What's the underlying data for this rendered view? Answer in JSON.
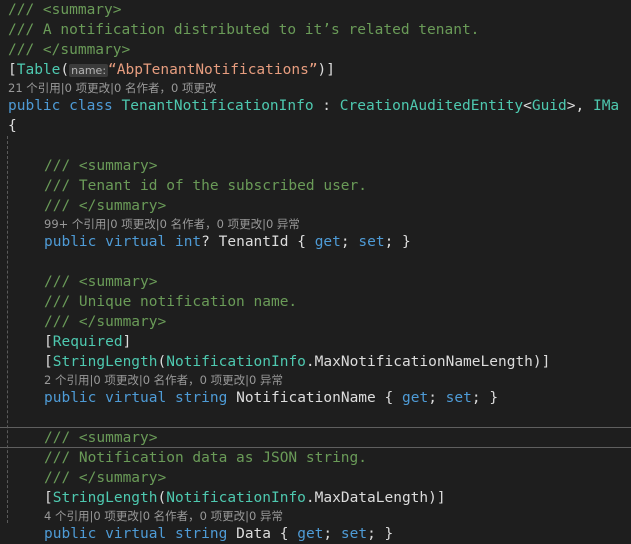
{
  "editor": {
    "name": "code-editor-pane",
    "background": "#1e1e1e",
    "foreground": "#dcdcdc",
    "language": "csharp",
    "colors": {
      "comment": "#6a9b58",
      "keyword": "#4e9bd6",
      "type": "#4ec9b0",
      "string": "#e79d7f",
      "identifier": "#dcdcdc",
      "codelens": "#999999",
      "indent_guide": "#5a5a5a",
      "current_line_border": "#5f5f5f",
      "inline_hint_background": "#3b3b3b"
    }
  },
  "code_lines": [
    {
      "indent": 0,
      "tokens": [
        {
          "c": "cm",
          "t": "/// "
        },
        {
          "c": "cmtag",
          "t": "<summary>"
        }
      ]
    },
    {
      "indent": 0,
      "tokens": [
        {
          "c": "cm",
          "t": "/// A notification distributed to it’s related tenant."
        }
      ]
    },
    {
      "indent": 0,
      "tokens": [
        {
          "c": "cm",
          "t": "/// "
        },
        {
          "c": "cmtag",
          "t": "</summary>"
        }
      ]
    },
    {
      "indent": 0,
      "tokens": [
        {
          "c": "punc",
          "t": "["
        },
        {
          "c": "type",
          "t": "Table"
        },
        {
          "c": "punc",
          "t": "("
        },
        {
          "c": "hint",
          "t": "name:"
        },
        {
          "c": "str",
          "t": "“AbpTenantNotifications”"
        },
        {
          "c": "punc",
          "t": ")]"
        }
      ]
    },
    {
      "codelens": true,
      "text": "21 个引用|0 项更改|0 名作者，0 项更改"
    },
    {
      "indent": 0,
      "tokens": [
        {
          "c": "kw",
          "t": "public"
        },
        {
          "c": "id",
          "t": " "
        },
        {
          "c": "kw",
          "t": "class"
        },
        {
          "c": "id",
          "t": " "
        },
        {
          "c": "type",
          "t": "TenantNotificationInfo"
        },
        {
          "c": "punc",
          "t": " : "
        },
        {
          "c": "type",
          "t": "CreationAuditedEntity"
        },
        {
          "c": "punc",
          "t": "<"
        },
        {
          "c": "type",
          "t": "Guid"
        },
        {
          "c": "punc",
          "t": ">, "
        },
        {
          "c": "type",
          "t": "IMa"
        }
      ]
    },
    {
      "indent": 0,
      "tokens": [
        {
          "c": "punc",
          "t": "{"
        }
      ]
    },
    {
      "blank": true
    },
    {
      "indent": 1,
      "tokens": [
        {
          "c": "cm",
          "t": "/// "
        },
        {
          "c": "cmtag",
          "t": "<summary>"
        }
      ]
    },
    {
      "indent": 1,
      "tokens": [
        {
          "c": "cm",
          "t": "/// Tenant id of the subscribed user."
        }
      ]
    },
    {
      "indent": 1,
      "tokens": [
        {
          "c": "cm",
          "t": "/// "
        },
        {
          "c": "cmtag",
          "t": "</summary>"
        }
      ]
    },
    {
      "codelens": true,
      "indent": 1,
      "text": "99+ 个引用|0 项更改|0 名作者，0 项更改|0 异常"
    },
    {
      "indent": 1,
      "tokens": [
        {
          "c": "kw",
          "t": "public"
        },
        {
          "c": "id",
          "t": " "
        },
        {
          "c": "kw",
          "t": "virtual"
        },
        {
          "c": "id",
          "t": " "
        },
        {
          "c": "kw",
          "t": "int"
        },
        {
          "c": "punc",
          "t": "? "
        },
        {
          "c": "id",
          "t": "TenantId"
        },
        {
          "c": "punc",
          "t": " { "
        },
        {
          "c": "kw",
          "t": "get"
        },
        {
          "c": "punc",
          "t": "; "
        },
        {
          "c": "kw",
          "t": "set"
        },
        {
          "c": "punc",
          "t": "; }"
        }
      ]
    },
    {
      "blank": true
    },
    {
      "indent": 1,
      "tokens": [
        {
          "c": "cm",
          "t": "/// "
        },
        {
          "c": "cmtag",
          "t": "<summary>"
        }
      ]
    },
    {
      "indent": 1,
      "tokens": [
        {
          "c": "cm",
          "t": "/// Unique notification name."
        }
      ]
    },
    {
      "indent": 1,
      "tokens": [
        {
          "c": "cm",
          "t": "/// "
        },
        {
          "c": "cmtag",
          "t": "</summary>"
        }
      ]
    },
    {
      "indent": 1,
      "tokens": [
        {
          "c": "punc",
          "t": "["
        },
        {
          "c": "type",
          "t": "Required"
        },
        {
          "c": "punc",
          "t": "]"
        }
      ]
    },
    {
      "indent": 1,
      "tokens": [
        {
          "c": "punc",
          "t": "["
        },
        {
          "c": "type",
          "t": "StringLength"
        },
        {
          "c": "punc",
          "t": "("
        },
        {
          "c": "type",
          "t": "NotificationInfo"
        },
        {
          "c": "punc",
          "t": "."
        },
        {
          "c": "id",
          "t": "MaxNotificationNameLength"
        },
        {
          "c": "punc",
          "t": ")]"
        }
      ]
    },
    {
      "codelens": true,
      "indent": 1,
      "text": "2 个引用|0 项更改|0 名作者，0 项更改|0 异常"
    },
    {
      "indent": 1,
      "tokens": [
        {
          "c": "kw",
          "t": "public"
        },
        {
          "c": "id",
          "t": " "
        },
        {
          "c": "kw",
          "t": "virtual"
        },
        {
          "c": "id",
          "t": " "
        },
        {
          "c": "kw",
          "t": "string"
        },
        {
          "c": "id",
          "t": " "
        },
        {
          "c": "id",
          "t": "NotificationName"
        },
        {
          "c": "punc",
          "t": " { "
        },
        {
          "c": "kw",
          "t": "get"
        },
        {
          "c": "punc",
          "t": "; "
        },
        {
          "c": "kw",
          "t": "set"
        },
        {
          "c": "punc",
          "t": "; }"
        }
      ]
    },
    {
      "blank": true
    },
    {
      "indent": 1,
      "current": true,
      "tokens": [
        {
          "c": "cm",
          "t": "/// "
        },
        {
          "c": "cmtag",
          "t": "<summary>"
        }
      ]
    },
    {
      "indent": 1,
      "tokens": [
        {
          "c": "cm",
          "t": "/// Notification data as JSON string."
        }
      ]
    },
    {
      "indent": 1,
      "tokens": [
        {
          "c": "cm",
          "t": "/// "
        },
        {
          "c": "cmtag",
          "t": "</summary>"
        }
      ]
    },
    {
      "indent": 1,
      "tokens": [
        {
          "c": "punc",
          "t": "["
        },
        {
          "c": "type",
          "t": "StringLength"
        },
        {
          "c": "punc",
          "t": "("
        },
        {
          "c": "type",
          "t": "NotificationInfo"
        },
        {
          "c": "punc",
          "t": "."
        },
        {
          "c": "id",
          "t": "MaxDataLength"
        },
        {
          "c": "punc",
          "t": ")]"
        }
      ]
    },
    {
      "codelens": true,
      "indent": 1,
      "text": "4 个引用|0 项更改|0 名作者，0 项更改|0 异常"
    },
    {
      "indent": 1,
      "tokens": [
        {
          "c": "kw",
          "t": "public"
        },
        {
          "c": "id",
          "t": " "
        },
        {
          "c": "kw",
          "t": "virtual"
        },
        {
          "c": "id",
          "t": " "
        },
        {
          "c": "kw",
          "t": "string"
        },
        {
          "c": "id",
          "t": " "
        },
        {
          "c": "id",
          "t": "Data"
        },
        {
          "c": "punc",
          "t": " { "
        },
        {
          "c": "kw",
          "t": "get"
        },
        {
          "c": "punc",
          "t": "; "
        },
        {
          "c": "kw",
          "t": "set"
        },
        {
          "c": "punc",
          "t": "; }"
        }
      ]
    }
  ]
}
